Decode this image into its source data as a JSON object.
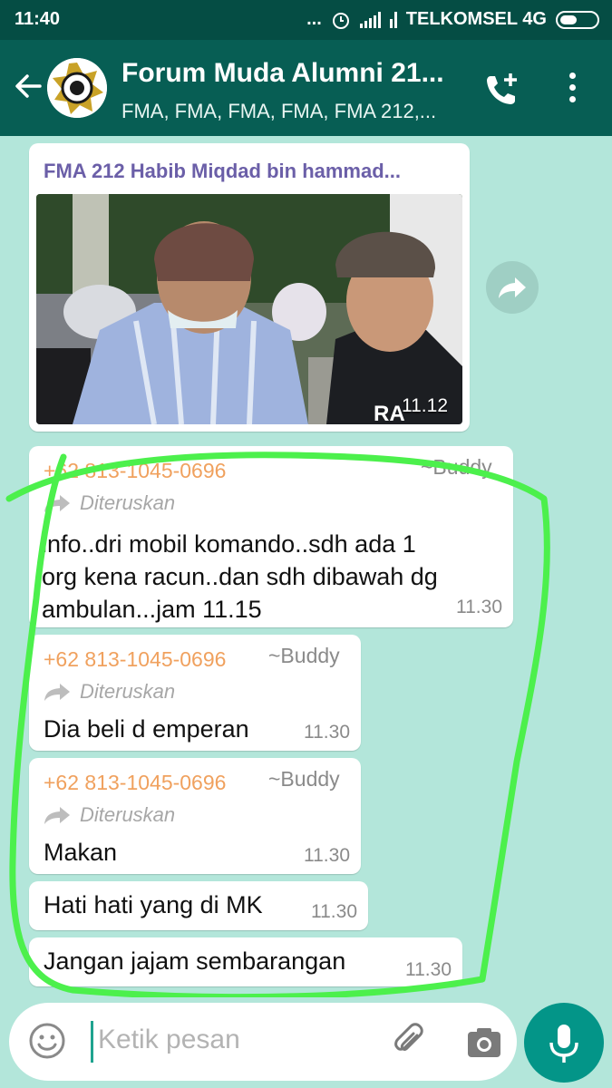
{
  "status_bar": {
    "time": "11:40",
    "dots": "...",
    "carrier": "TELKOMSEL 4G"
  },
  "header": {
    "title": "Forum Muda Alumni 21...",
    "subtitle": "FMA, FMA, FMA, FMA, FMA 212,..."
  },
  "messages": {
    "photo": {
      "caption": "FMA 212 Habib Miqdad bin hammad...",
      "time": "11.12"
    },
    "m1": {
      "sender": "+62 813-1045-0696",
      "alias": "~Buddy",
      "forwarded": "Diteruskan",
      "text_l1": "info..dri mobil komando..sdh ada 1",
      "text_l2": "org kena racun..dan sdh dibawah dg",
      "text_l3": "ambulan...jam 11.15",
      "time": "11.30"
    },
    "m2": {
      "sender": "+62 813-1045-0696",
      "alias": "~Buddy",
      "forwarded": "Diteruskan",
      "text": "Dia beli d emperan",
      "time": "11.30"
    },
    "m3": {
      "sender": "+62 813-1045-0696",
      "alias": "~Buddy",
      "forwarded": "Diteruskan",
      "text": "Makan",
      "time": "11.30"
    },
    "m4": {
      "text": "Hati hati yang di MK",
      "time": "11.30"
    },
    "m5": {
      "text": "Jangan jajam sembarangan",
      "time": "11.30"
    }
  },
  "input": {
    "placeholder": "Ketik pesan"
  },
  "colors": {
    "header": "#075e54",
    "status_bar": "#054d44",
    "chat_bg": "#b3e6da",
    "sender": "#f0a15e",
    "annotation": "#4cf04c",
    "mic_button": "#039588"
  },
  "icons": [
    "back-arrow-icon",
    "group-avatar",
    "add-call-icon",
    "more-vert-icon",
    "share-forward-icon",
    "forward-icon",
    "emoji-icon",
    "attach-icon",
    "camera-icon",
    "mic-icon"
  ]
}
